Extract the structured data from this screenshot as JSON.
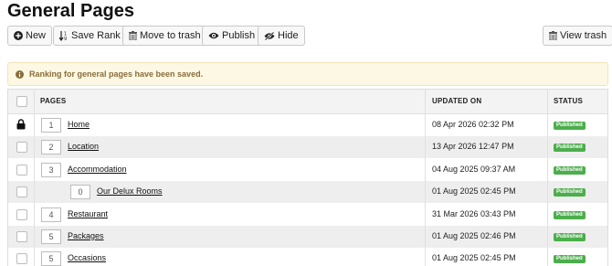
{
  "page": {
    "title": "General Pages"
  },
  "toolbar": {
    "new_label": "New",
    "save_rank_label": "Save Rank",
    "move_trash_label": "Move to trash",
    "publish_label": "Publish",
    "hide_label": "Hide",
    "view_trash_label": "View trash"
  },
  "alert": {
    "message": "Ranking for general pages have been saved."
  },
  "table": {
    "headers": {
      "pages": "PAGES",
      "updated_on": "UPDATED ON",
      "status": "STATUS"
    },
    "rows": [
      {
        "rank": "1",
        "name": "Home",
        "updated": "08 Apr 2026 02:32 PM",
        "status": "Published",
        "locked": true,
        "child": false
      },
      {
        "rank": "2",
        "name": "Location",
        "updated": "13 Apr 2026 12:47 PM",
        "status": "Published",
        "locked": false,
        "child": false
      },
      {
        "rank": "3",
        "name": "Accommodation",
        "updated": "04 Aug 2025 09:37 AM",
        "status": "Published",
        "locked": false,
        "child": false
      },
      {
        "rank": "0",
        "name": "Our Delux Rooms",
        "updated": "01 Aug 2025 02:45 PM",
        "status": "Published",
        "locked": false,
        "child": true
      },
      {
        "rank": "4",
        "name": "Restaurant",
        "updated": "31 Mar 2026 03:43 PM",
        "status": "Published",
        "locked": false,
        "child": false
      },
      {
        "rank": "5",
        "name": "Packages",
        "updated": "01 Aug 2025 02:46 PM",
        "status": "Published",
        "locked": false,
        "child": false
      },
      {
        "rank": "5",
        "name": "Occasions",
        "updated": "01 Aug 2025 02:45 PM",
        "status": "Published",
        "locked": false,
        "child": false
      }
    ]
  },
  "colors": {
    "published": "#4cae4c",
    "alert_bg": "#fcf8e3",
    "alert_text": "#8a6d3b"
  }
}
